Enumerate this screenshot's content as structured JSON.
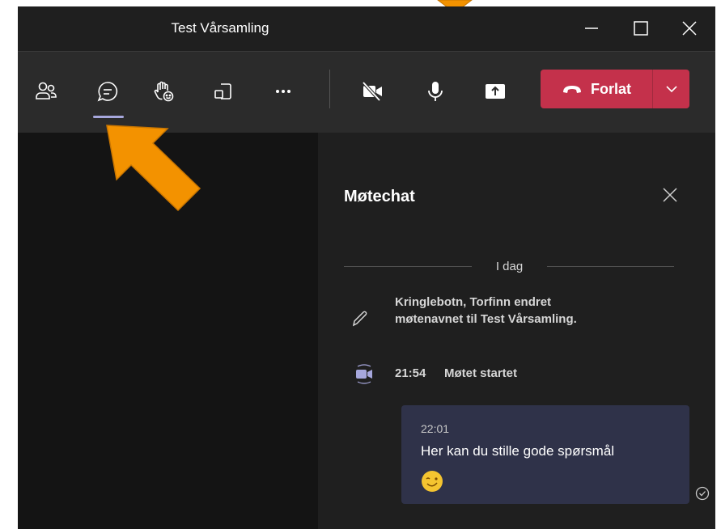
{
  "window": {
    "title": "Test Vårsamling"
  },
  "toolbar": {
    "buttons": [
      "people-icon",
      "chat-icon",
      "raise-hand-icon",
      "share-tray-icon",
      "more-icon",
      "camera-off-icon",
      "microphone-icon",
      "share-screen-icon"
    ],
    "leave_label": "Forlat"
  },
  "chat": {
    "title": "Møtechat",
    "day_divider": "I dag",
    "event_rename": "Kringlebotn, Torfinn endret møtenavnet til Test Vårsamling.",
    "event_start_time": "21:54",
    "event_start_text": "Møtet startet",
    "message": {
      "time": "22:01",
      "text": "Her kan du stille gode spørsmål",
      "emoji": "winking-smiley"
    }
  },
  "colors": {
    "accent": "#a6a7dc",
    "leave": "#c4314b",
    "bubble": "#2f3249",
    "annotation_arrow": "#f39200"
  }
}
